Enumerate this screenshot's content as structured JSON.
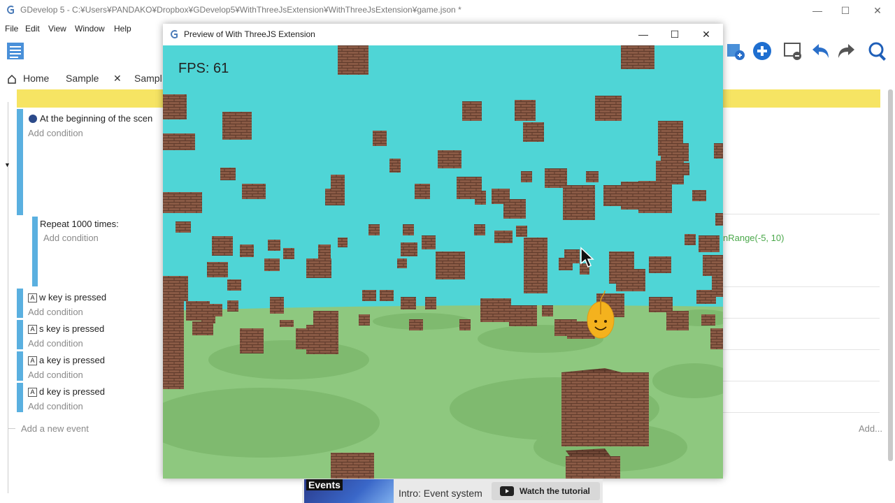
{
  "window": {
    "title": "GDevelop 5 - C:¥Users¥PANDAKO¥Dropbox¥GDevelop5¥WithThreeJsExtension¥WithThreeJsExtension¥game.json *"
  },
  "menu": [
    "File",
    "Edit",
    "View",
    "Window",
    "Help"
  ],
  "tabs": {
    "home": "Home",
    "sample": "Sample",
    "sample_partial": "Sampl"
  },
  "events": {
    "begin_condition": "At the beginning of the scen",
    "add_condition": "Add condition",
    "repeat_label": "Repeat 1000 times:",
    "keys": [
      {
        "key": "w",
        "text": "w key is pressed"
      },
      {
        "key": "s",
        "text": "s key is pressed"
      },
      {
        "key": "a",
        "text": "a key is pressed"
      },
      {
        "key": "d",
        "text": "d key is pressed"
      }
    ],
    "add_event": "Add a new event",
    "action_snippet": "nRange(-5, 10)",
    "add_more": "Add..."
  },
  "preview": {
    "title": "Preview of With ThreeJS Extension",
    "fps": "FPS: 61"
  },
  "tutorial": {
    "thumb_label": "Events",
    "text": "Intro: Event system",
    "button": "Watch the tutorial"
  },
  "colors": {
    "sky": "#4fd5d6",
    "ground": "#8ec87f",
    "brick": "#8a5a45",
    "highlight_yellow": "#f6e463",
    "event_blue": "#5ab0e0"
  },
  "icons": [
    "gdevelop-logo-icon",
    "minimize-icon",
    "maximize-icon",
    "close-icon",
    "home-icon",
    "events-sheet-icon",
    "add-object-icon",
    "add-event-icon",
    "scene-editor-icon",
    "undo-icon",
    "redo-icon",
    "search-icon",
    "mouse-cursor-icon",
    "mouse-mascot-icon",
    "youtube-icon"
  ]
}
